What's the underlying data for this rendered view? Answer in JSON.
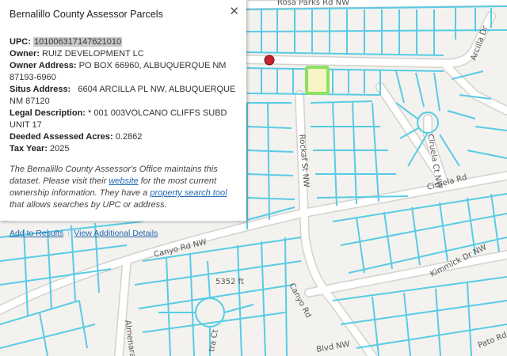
{
  "popup": {
    "title": "Bernalillo County Assessor Parcels",
    "close_symbol": "✕",
    "fields": {
      "upc_label": "UPC:",
      "upc_value": "101006317147621010",
      "owner_label": "Owner:",
      "owner_value": "RUIZ DEVELOPMENT LC",
      "owner_address_label": "Owner Address:",
      "owner_address_value": "PO BOX 66960, ALBUQUERQUE NM 87193-6960",
      "situs_label": "Situs Address:",
      "situs_value": "6604 ARCILLA PL NW, ALBUQUERQUE NM 87120",
      "legal_label": "Legal Description:",
      "legal_value": "* 001 003VOLCANO CLIFFS SUBD UNIT 17",
      "acres_label": "Deeded Assessed Acres:",
      "acres_value": "0.2862",
      "tax_year_label": "Tax Year:",
      "tax_year_value": "2025"
    },
    "description": {
      "part1": "The Bernalillo County Assessor's Office maintains this dataset. Please visit their ",
      "website_link": "website",
      "part2": " for the most current ownership information. They have a ",
      "search_link": "property search tool",
      "part3": " that allows searches by UPC or address."
    },
    "actions": {
      "add_to_results": "Add to Results",
      "view_details": "View Additional Details"
    }
  },
  "map": {
    "labels": {
      "rosa_parks": "Rosa Parks Rd NW",
      "arcilla": "Arcilla Dr",
      "rockaf": "Rockaf St NW",
      "ciruela_ct": "Ciruela Ct NW",
      "ciruela_rd": "Ciruela Rd",
      "canyo_rd_nw": "Canyo Rd NW",
      "kimmick": "Kimmick Dr NW",
      "elev": "5352 ft",
      "canyo_rd": "Canyo Rd",
      "almenara": "Almenara",
      "blvd_nw": "Blvd NW",
      "tra_ct": "tra Ct",
      "pato": "Pato Rd"
    },
    "colors": {
      "parcel": "#58cbe6",
      "road": "#ffffff",
      "road_casing": "#d4d2cc",
      "selected_parcel": "#8ee060",
      "selected_fill": "#f6f3c6",
      "marker": "#c8232c"
    }
  }
}
